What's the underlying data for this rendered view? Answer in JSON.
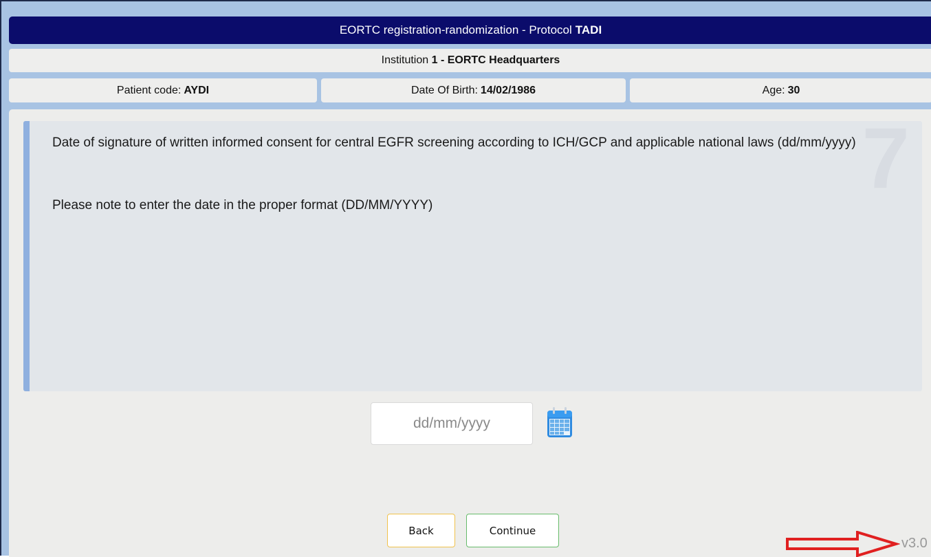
{
  "header": {
    "title_prefix": "EORTC registration-randomization - Protocol",
    "protocol": "TADI"
  },
  "institution": {
    "prefix": "Institution",
    "code": "1 - EORTC Headquarters"
  },
  "patient": {
    "code_label": "Patient code:",
    "code": "AYDI",
    "dob_label": "Date Of Birth:",
    "dob": "14/02/1986",
    "age_label": "Age:",
    "age": "30"
  },
  "question": {
    "step": "7",
    "text": "Date of signature of written informed consent for central EGFR screening according to ICH/GCP and applicable national laws (dd/mm/yyyy)",
    "note": "Please note to enter the date in the proper format (DD/MM/YYYY)"
  },
  "date_field": {
    "placeholder": "dd/mm/yyyy",
    "value": ""
  },
  "buttons": {
    "back": "Back",
    "continue": "Continue"
  },
  "footer": {
    "version": "v3.0"
  },
  "colors": {
    "title_bg": "#0b0c6b",
    "frame_bg": "#a8c3e3",
    "panel_bg": "#ededeb",
    "question_bg": "#e2e6ea",
    "question_accent": "#8fb0df",
    "back_border": "#f0c14b",
    "continue_border": "#66bb6a",
    "arrow": "#e02020"
  },
  "icons": {
    "calendar": "calendar-icon",
    "annotation_arrow": "red-arrow-icon"
  }
}
